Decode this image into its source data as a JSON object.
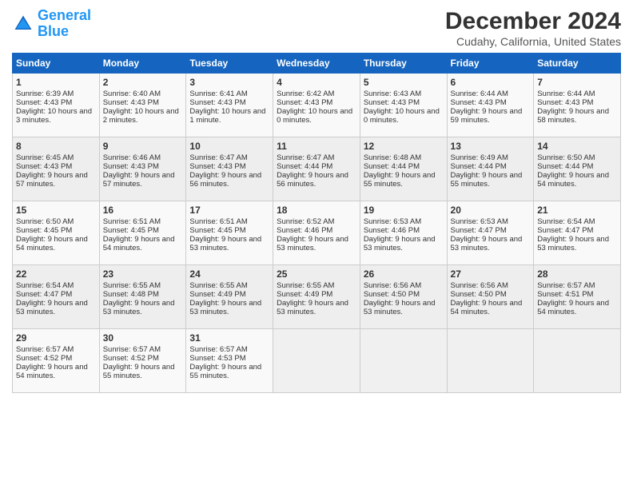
{
  "logo": {
    "line1": "General",
    "line2": "Blue"
  },
  "title": "December 2024",
  "subtitle": "Cudahy, California, United States",
  "headers": [
    "Sunday",
    "Monday",
    "Tuesday",
    "Wednesday",
    "Thursday",
    "Friday",
    "Saturday"
  ],
  "weeks": [
    [
      {
        "day": "1",
        "sunrise": "Sunrise: 6:39 AM",
        "sunset": "Sunset: 4:43 PM",
        "daylight": "Daylight: 10 hours and 3 minutes."
      },
      {
        "day": "2",
        "sunrise": "Sunrise: 6:40 AM",
        "sunset": "Sunset: 4:43 PM",
        "daylight": "Daylight: 10 hours and 2 minutes."
      },
      {
        "day": "3",
        "sunrise": "Sunrise: 6:41 AM",
        "sunset": "Sunset: 4:43 PM",
        "daylight": "Daylight: 10 hours and 1 minute."
      },
      {
        "day": "4",
        "sunrise": "Sunrise: 6:42 AM",
        "sunset": "Sunset: 4:43 PM",
        "daylight": "Daylight: 10 hours and 0 minutes."
      },
      {
        "day": "5",
        "sunrise": "Sunrise: 6:43 AM",
        "sunset": "Sunset: 4:43 PM",
        "daylight": "Daylight: 10 hours and 0 minutes."
      },
      {
        "day": "6",
        "sunrise": "Sunrise: 6:44 AM",
        "sunset": "Sunset: 4:43 PM",
        "daylight": "Daylight: 9 hours and 59 minutes."
      },
      {
        "day": "7",
        "sunrise": "Sunrise: 6:44 AM",
        "sunset": "Sunset: 4:43 PM",
        "daylight": "Daylight: 9 hours and 58 minutes."
      }
    ],
    [
      {
        "day": "8",
        "sunrise": "Sunrise: 6:45 AM",
        "sunset": "Sunset: 4:43 PM",
        "daylight": "Daylight: 9 hours and 57 minutes."
      },
      {
        "day": "9",
        "sunrise": "Sunrise: 6:46 AM",
        "sunset": "Sunset: 4:43 PM",
        "daylight": "Daylight: 9 hours and 57 minutes."
      },
      {
        "day": "10",
        "sunrise": "Sunrise: 6:47 AM",
        "sunset": "Sunset: 4:43 PM",
        "daylight": "Daylight: 9 hours and 56 minutes."
      },
      {
        "day": "11",
        "sunrise": "Sunrise: 6:47 AM",
        "sunset": "Sunset: 4:44 PM",
        "daylight": "Daylight: 9 hours and 56 minutes."
      },
      {
        "day": "12",
        "sunrise": "Sunrise: 6:48 AM",
        "sunset": "Sunset: 4:44 PM",
        "daylight": "Daylight: 9 hours and 55 minutes."
      },
      {
        "day": "13",
        "sunrise": "Sunrise: 6:49 AM",
        "sunset": "Sunset: 4:44 PM",
        "daylight": "Daylight: 9 hours and 55 minutes."
      },
      {
        "day": "14",
        "sunrise": "Sunrise: 6:50 AM",
        "sunset": "Sunset: 4:44 PM",
        "daylight": "Daylight: 9 hours and 54 minutes."
      }
    ],
    [
      {
        "day": "15",
        "sunrise": "Sunrise: 6:50 AM",
        "sunset": "Sunset: 4:45 PM",
        "daylight": "Daylight: 9 hours and 54 minutes."
      },
      {
        "day": "16",
        "sunrise": "Sunrise: 6:51 AM",
        "sunset": "Sunset: 4:45 PM",
        "daylight": "Daylight: 9 hours and 54 minutes."
      },
      {
        "day": "17",
        "sunrise": "Sunrise: 6:51 AM",
        "sunset": "Sunset: 4:45 PM",
        "daylight": "Daylight: 9 hours and 53 minutes."
      },
      {
        "day": "18",
        "sunrise": "Sunrise: 6:52 AM",
        "sunset": "Sunset: 4:46 PM",
        "daylight": "Daylight: 9 hours and 53 minutes."
      },
      {
        "day": "19",
        "sunrise": "Sunrise: 6:53 AM",
        "sunset": "Sunset: 4:46 PM",
        "daylight": "Daylight: 9 hours and 53 minutes."
      },
      {
        "day": "20",
        "sunrise": "Sunrise: 6:53 AM",
        "sunset": "Sunset: 4:47 PM",
        "daylight": "Daylight: 9 hours and 53 minutes."
      },
      {
        "day": "21",
        "sunrise": "Sunrise: 6:54 AM",
        "sunset": "Sunset: 4:47 PM",
        "daylight": "Daylight: 9 hours and 53 minutes."
      }
    ],
    [
      {
        "day": "22",
        "sunrise": "Sunrise: 6:54 AM",
        "sunset": "Sunset: 4:47 PM",
        "daylight": "Daylight: 9 hours and 53 minutes."
      },
      {
        "day": "23",
        "sunrise": "Sunrise: 6:55 AM",
        "sunset": "Sunset: 4:48 PM",
        "daylight": "Daylight: 9 hours and 53 minutes."
      },
      {
        "day": "24",
        "sunrise": "Sunrise: 6:55 AM",
        "sunset": "Sunset: 4:49 PM",
        "daylight": "Daylight: 9 hours and 53 minutes."
      },
      {
        "day": "25",
        "sunrise": "Sunrise: 6:55 AM",
        "sunset": "Sunset: 4:49 PM",
        "daylight": "Daylight: 9 hours and 53 minutes."
      },
      {
        "day": "26",
        "sunrise": "Sunrise: 6:56 AM",
        "sunset": "Sunset: 4:50 PM",
        "daylight": "Daylight: 9 hours and 53 minutes."
      },
      {
        "day": "27",
        "sunrise": "Sunrise: 6:56 AM",
        "sunset": "Sunset: 4:50 PM",
        "daylight": "Daylight: 9 hours and 54 minutes."
      },
      {
        "day": "28",
        "sunrise": "Sunrise: 6:57 AM",
        "sunset": "Sunset: 4:51 PM",
        "daylight": "Daylight: 9 hours and 54 minutes."
      }
    ],
    [
      {
        "day": "29",
        "sunrise": "Sunrise: 6:57 AM",
        "sunset": "Sunset: 4:52 PM",
        "daylight": "Daylight: 9 hours and 54 minutes."
      },
      {
        "day": "30",
        "sunrise": "Sunrise: 6:57 AM",
        "sunset": "Sunset: 4:52 PM",
        "daylight": "Daylight: 9 hours and 55 minutes."
      },
      {
        "day": "31",
        "sunrise": "Sunrise: 6:57 AM",
        "sunset": "Sunset: 4:53 PM",
        "daylight": "Daylight: 9 hours and 55 minutes."
      },
      null,
      null,
      null,
      null
    ]
  ]
}
